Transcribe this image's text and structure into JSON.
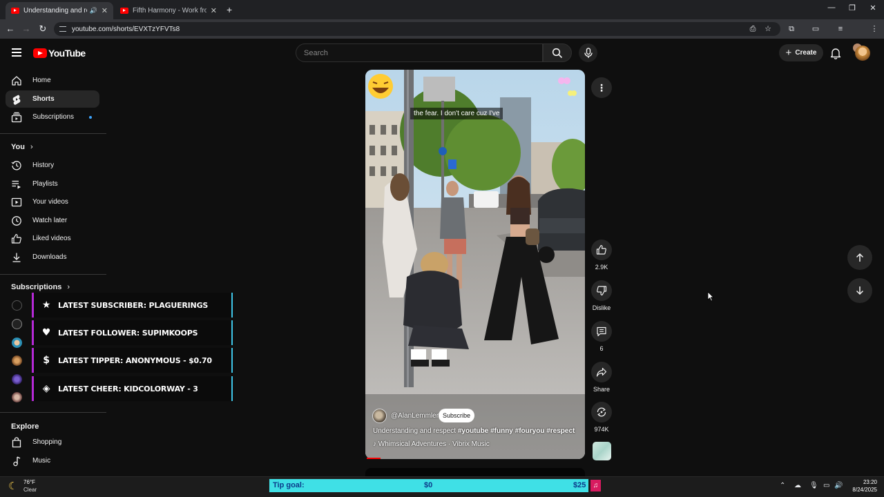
{
  "browser": {
    "tabs": [
      {
        "title": "Understanding and respect"
      },
      {
        "title": "Fifth Harmony - Work from Ho"
      }
    ],
    "new_tab": "+",
    "url": "youtube.com/shorts/EVXTzYFVTs8",
    "window_controls": {
      "minimize": "—",
      "restore": "❐",
      "close": "✕"
    }
  },
  "header": {
    "logo_text": "YouTube",
    "search_placeholder": "Search",
    "create_label": "Create"
  },
  "sidebar": {
    "main": [
      {
        "label": "Home",
        "icon": "home-icon"
      },
      {
        "label": "Shorts",
        "icon": "shorts-icon",
        "active": true
      },
      {
        "label": "Subscriptions",
        "icon": "subscriptions-icon"
      }
    ],
    "you_title": "You",
    "you": [
      {
        "label": "History",
        "icon": "history-icon"
      },
      {
        "label": "Playlists",
        "icon": "playlists-icon"
      },
      {
        "label": "Your videos",
        "icon": "your-videos-icon"
      },
      {
        "label": "Watch later",
        "icon": "watch-later-icon"
      },
      {
        "label": "Liked videos",
        "icon": "liked-videos-icon"
      },
      {
        "label": "Downloads",
        "icon": "downloads-icon"
      }
    ],
    "subscriptions_title": "Subscriptions",
    "explore_title": "Explore",
    "explore": [
      {
        "label": "Shopping",
        "icon": "shopping-icon"
      },
      {
        "label": "Music",
        "icon": "music-icon"
      }
    ]
  },
  "overlay_alerts": [
    {
      "text": "Latest Subscriber: plaguerings",
      "icon": "star-icon"
    },
    {
      "text": "Latest Follower: supimkoops",
      "icon": "heart-icon"
    },
    {
      "text": "Latest Tipper: Anonymous - $0.70",
      "icon": "dollar-icon"
    },
    {
      "text": "Latest Cheer: kidcolorway - 3",
      "icon": "diamond-icon"
    }
  ],
  "short": {
    "caption": "the fear. I don't care cuz I've",
    "channel": "@AlanLemmler",
    "subscribe_label": "Subscribe",
    "title_plain": "Understanding and respect",
    "hashtags": "#youtube #funny #fouryou #respect",
    "music": "Whimsical Adventures · Vibrix Music"
  },
  "actions": {
    "likes": "2.9K",
    "dislike_label": "Dislike",
    "comments": "6",
    "share_label": "Share",
    "remix_count": "974K"
  },
  "taskbar": {
    "weather_temp": "76°F",
    "weather_cond": "Clear",
    "tip_label": "Tip goal:",
    "tip_current": "$0",
    "tip_goal": "$25",
    "time": "23:20",
    "date": "8/24/2025"
  },
  "colors": {
    "accent_red": "#ff0000",
    "overlay_purple": "#b529d6",
    "overlay_cyan": "#3fc6e8",
    "tip_bar": "#3fe0e6"
  }
}
